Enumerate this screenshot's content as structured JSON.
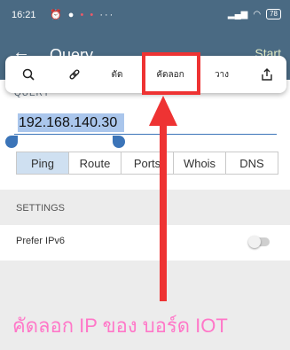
{
  "status_bar": {
    "time": "16:21",
    "icons": [
      "alarm-icon",
      "chat-icon"
    ],
    "dots": "• •",
    "more": "···",
    "right_icons": [
      "signal-icon",
      "wifi-icon"
    ],
    "battery": "78"
  },
  "app_bar": {
    "back_icon": "back-arrow-icon",
    "title": "Query",
    "action": "Start"
  },
  "context_toolbar": {
    "items": [
      {
        "name": "search-icon",
        "label": ""
      },
      {
        "name": "link-icon",
        "label": ""
      },
      {
        "name": "cut",
        "label": "ตัด"
      },
      {
        "name": "copy",
        "label": "คัดลอก"
      },
      {
        "name": "paste",
        "label": "วาง"
      },
      {
        "name": "share-icon",
        "label": ""
      }
    ]
  },
  "query_section": {
    "label": "QUERY",
    "ip_value": "192.168.140.30"
  },
  "tabs": {
    "items": [
      "Ping",
      "Route",
      "Ports",
      "Whois",
      "DNS"
    ],
    "active": "Ping"
  },
  "settings": {
    "header": "SETTINGS",
    "prefer_ipv6_label": "Prefer IPv6",
    "prefer_ipv6_on": false
  },
  "annotation": {
    "caption": "คัดลอก IP ของ บอร์ด IOT",
    "color": "#ff77c8",
    "highlight_color": "#ee3333"
  }
}
